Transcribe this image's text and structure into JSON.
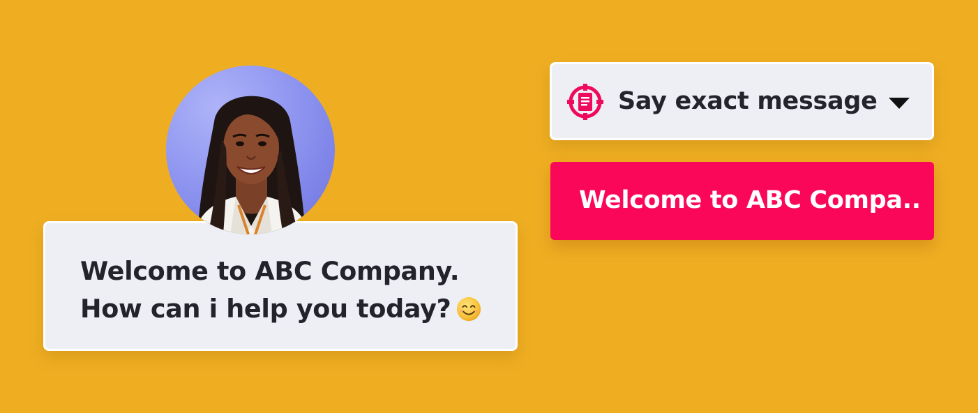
{
  "colors": {
    "background": "#EFAE22",
    "card": "#EEEFF4",
    "accent": "#FB0759",
    "text_dark": "#23232B",
    "text_light": "#FFFFFF"
  },
  "avatar": {
    "icon": "agent-avatar-photo"
  },
  "chat_bubble": {
    "line1": "Welcome to ABC Company.",
    "line2": "How can i help you today?",
    "emoji": "smiling-face-emoji"
  },
  "action_dropdown": {
    "icon": "document-target-icon",
    "selected_value": "Say exact message",
    "chevron_icon": "caret-down-icon"
  },
  "message_button": {
    "label": "Welcome to ABC Compa.."
  }
}
